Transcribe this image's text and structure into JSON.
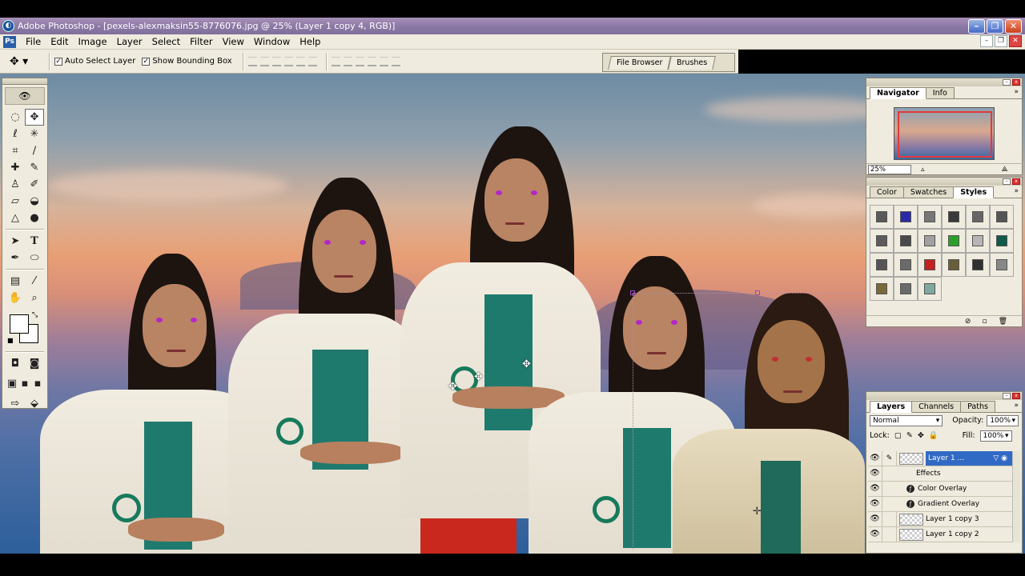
{
  "window": {
    "title": "Adobe Photoshop - [pexels-alexmaksin55-8776076.jpg @ 25% (Layer 1 copy 4, RGB)]"
  },
  "menu": {
    "items": [
      "File",
      "Edit",
      "Image",
      "Layer",
      "Select",
      "Filter",
      "View",
      "Window",
      "Help"
    ]
  },
  "options": {
    "auto_select": "Auto Select Layer",
    "auto_select_checked": true,
    "show_bounding": "Show Bounding Box",
    "show_bounding_checked": true
  },
  "palette_well": {
    "tabs": [
      "File Browser",
      "Brushes"
    ]
  },
  "navigator": {
    "tabs": [
      "Navigator",
      "Info"
    ],
    "active_tab": "Navigator",
    "zoom": "25%"
  },
  "styles_panel": {
    "tabs": [
      "Color",
      "Swatches",
      "Styles"
    ],
    "active_tab": "Styles",
    "swatch_colors": [
      "#5a5a5a",
      "#2a2aa8",
      "#777777",
      "#3a3a3a",
      "#666666",
      "#555555",
      "#5c5c5c",
      "#4a4a4a",
      "#a0a0a0",
      "#2aa02a",
      "#b5b5b5",
      "#0f5a4a",
      "#555555",
      "#6a6a6a",
      "#c42020",
      "#6a5e3a",
      "#303030",
      "#888888",
      "#7a6a3a",
      "#6a6a6a",
      "#7fa89e"
    ]
  },
  "layers_panel": {
    "tabs": [
      "Layers",
      "Channels",
      "Paths"
    ],
    "active_tab": "Layers",
    "blend_mode": "Normal",
    "opacity_label": "Opacity:",
    "opacity": "100%",
    "lock_label": "Lock:",
    "fill_label": "Fill:",
    "fill": "100%",
    "rows": [
      {
        "name": "Layer 1 ...",
        "type": "layer",
        "selected": true
      },
      {
        "name": "Effects",
        "type": "effects-header"
      },
      {
        "name": "Color Overlay",
        "type": "effect"
      },
      {
        "name": "Gradient Overlay",
        "type": "effect"
      },
      {
        "name": "Layer 1 copy 3",
        "type": "layer"
      },
      {
        "name": "Layer 1 copy 2",
        "type": "layer"
      }
    ]
  },
  "colors": {
    "fg": "#ffffff",
    "bg": "#ffffff",
    "ui_face": "#efebde",
    "selection": "#316ac5"
  }
}
